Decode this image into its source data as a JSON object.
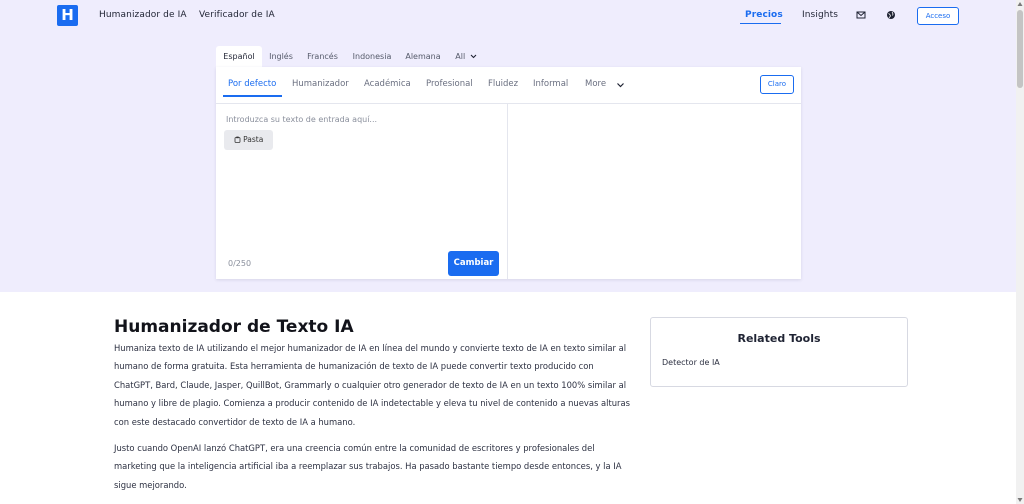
{
  "header": {
    "logo_letter": "H",
    "nav": [
      "Humanizador de IA",
      "Verificador de IA"
    ],
    "pricing": "Precios",
    "insights": "Insights",
    "login": "Acceso",
    "icons": [
      "mail-icon",
      "globe-icon"
    ],
    "accent": "#1a6cf0"
  },
  "languages": {
    "tabs": [
      "Español",
      "Inglés",
      "Francés",
      "Indonesia",
      "Alemana",
      "All"
    ],
    "selected": "Español"
  },
  "modes": {
    "tabs": [
      "Por defecto",
      "Humanizador",
      "Académica",
      "Profesional",
      "Fluidez",
      "Informal",
      "More"
    ],
    "selected": "Por defecto",
    "clear": "Claro"
  },
  "editor": {
    "placeholder": "Introduzca su texto de entrada aquí...",
    "paste": "Pasta",
    "counter": "0/250",
    "submit": "Cambiar"
  },
  "content": {
    "title": "Humanizador de Texto IA",
    "paragraphs": [
      "Humaniza texto de IA utilizando el mejor humanizador de IA en línea del mundo y convierte texto de IA en texto similar al humano de forma gratuita. Esta herramienta de humanización de texto de IA puede convertir texto producido con ChatGPT, Bard, Claude, Jasper, QuillBot, Grammarly o cualquier otro generador de texto de IA en un texto 100% similar al humano y libre de plagio. Comienza a producir contenido de IA indetectable y eleva tu nivel de contenido a nuevas alturas con este destacado convertidor de texto de IA a humano.",
      "Justo cuando OpenAI lanzó ChatGPT, era una creencia común entre la comunidad de escritores y profesionales del marketing que la inteligencia artificial iba a reemplazar sus trabajos. Ha pasado bastante tiempo desde entonces, y la IA sigue mejorando."
    ]
  },
  "related": {
    "title": "Related Tools",
    "links": [
      "Detector de IA"
    ]
  }
}
